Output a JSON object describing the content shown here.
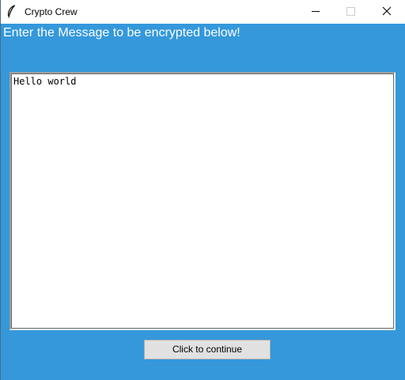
{
  "window": {
    "title": "Crypto Crew",
    "app_icon": "feather-icon",
    "controls": {
      "minimize_icon": "minimize-icon",
      "maximize_icon": "maximize-icon",
      "close_icon": "close-icon"
    }
  },
  "main": {
    "prompt": "Enter the Message to be encrypted below!",
    "message_value": "Hello world",
    "continue_label": "Click to continue"
  },
  "colors": {
    "background": "#3498db",
    "titlebar": "#ffffff",
    "prompt_text": "#ffffff",
    "button_face": "#e1e1e1",
    "button_border": "#adadad"
  }
}
